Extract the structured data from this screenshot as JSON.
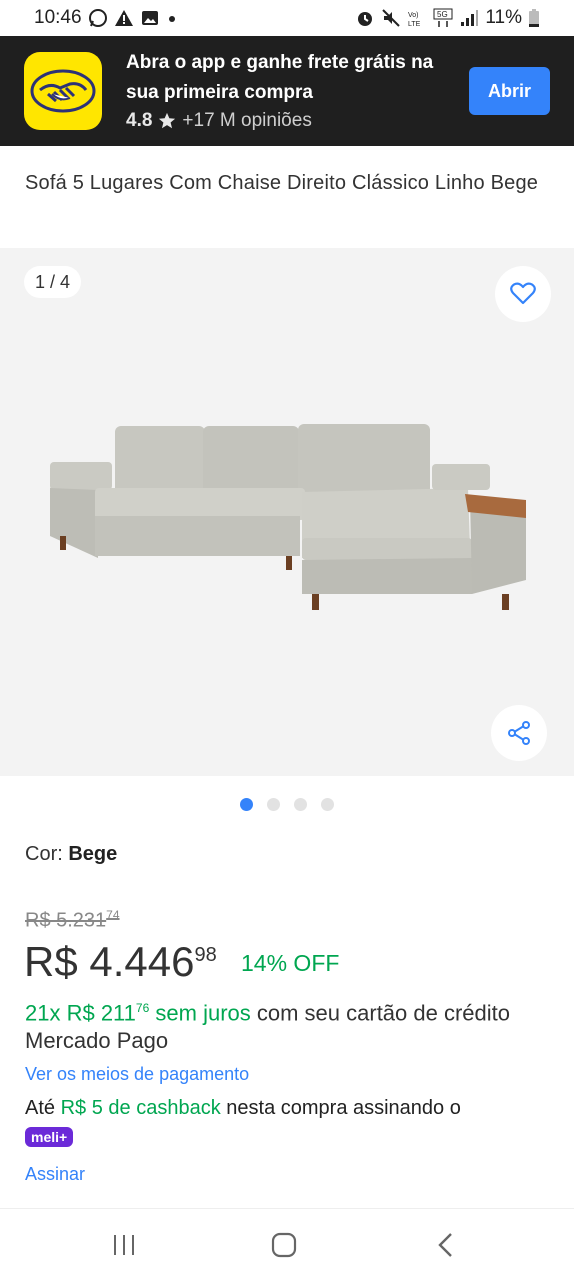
{
  "status_bar": {
    "time": "10:46",
    "battery": "11%",
    "icons_left": [
      "whatsapp-icon",
      "alert-icon",
      "image-icon",
      "dot-icon"
    ],
    "icons_right": [
      "alarm-icon",
      "mute-icon",
      "volte-icon",
      "5g-icon",
      "signal-icon",
      "battery-icon"
    ]
  },
  "banner": {
    "title": "Abra o app e ganhe frete grátis na sua primeira compra",
    "rating": "4.8",
    "reviews": "+17 M opiniões",
    "open_label": "Abrir",
    "logo_color": "#ffe600",
    "button_color": "#3483fa"
  },
  "product": {
    "title": "Sofá 5 Lugares Com Chaise Direito Clássico Linho Bege",
    "image_counter": "1 / 4",
    "image_total": 4,
    "active_image": 1,
    "color_label": "Cor:",
    "color_value": "Bege",
    "old_price_int": "R$ 5.231",
    "old_price_cents": "74",
    "price_int": "R$ 4.446",
    "price_cents": "98",
    "discount": "14% OFF",
    "installments_green": "21x R$ 211",
    "installments_cents": "76",
    "installments_green2": "sem juros",
    "installments_rest": "com seu cartão de crédito Mercado Pago",
    "payment_link": "Ver os meios de pagamento",
    "cashback_prefix": "Até",
    "cashback_green": "R$ 5 de cashback",
    "cashback_rest": "nesta compra assinando o",
    "meli_badge": "meli+",
    "subscribe_link": "Assinar"
  },
  "colors": {
    "accent": "#3483fa",
    "green": "#00a650",
    "meli_plus": "#6b2ad8"
  }
}
